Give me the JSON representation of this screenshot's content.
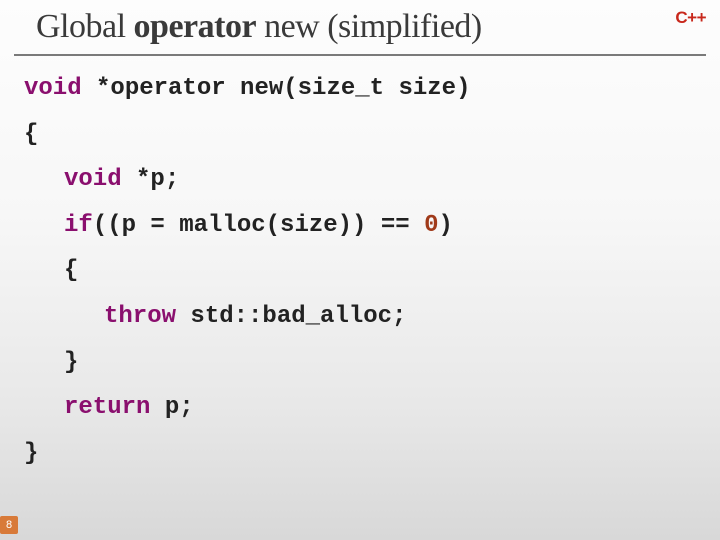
{
  "title": {
    "prefix": "Global ",
    "bold": "operator",
    "suffix": " new (simplified)"
  },
  "badge": "C++",
  "page_number": "8",
  "code": {
    "l1_kw": "void",
    "l1_rest": " *operator new(size_t size)",
    "l2": "{",
    "l3_kw": "void",
    "l3_rest": " *p;",
    "l4_kw": "if",
    "l4_mid": "((p = malloc(size)) == ",
    "l4_num": "0",
    "l4_end": ")",
    "l5": "{",
    "l6_kw": "throw",
    "l6_rest": " std::bad_alloc;",
    "l7": "}",
    "l8_kw": "return",
    "l8_rest": " p;",
    "l9": "}"
  }
}
